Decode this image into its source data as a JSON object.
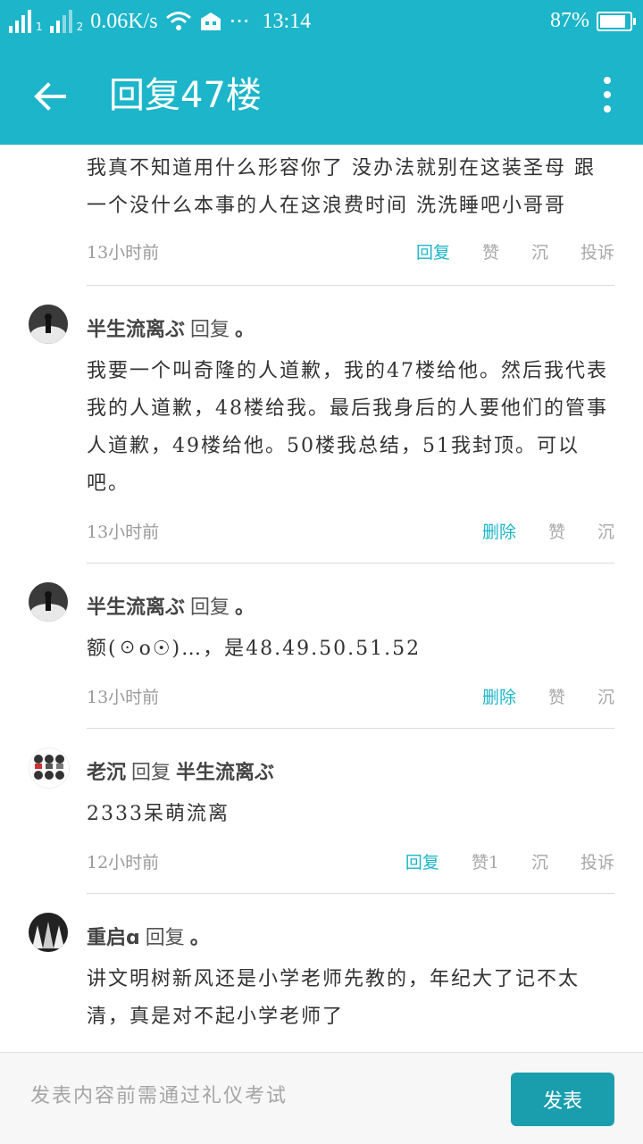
{
  "status_bar": {
    "network_speed": "0.06K/s",
    "dots": "···",
    "time": "13:14",
    "battery": "87%",
    "battery_level": 0.87,
    "sim1": "1",
    "sim2": "2"
  },
  "app_bar": {
    "title": "回复47楼"
  },
  "posts": [
    {
      "text": "我真不知道用什么形容你了 没办法就别在这装圣母 跟一个没什么本事的人在这浪费时间 洗洗睡吧小哥哥",
      "time": "13小时前",
      "actions": [
        "回复",
        "赞",
        "沉",
        "投诉"
      ]
    },
    {
      "author": "半生流离ぶ",
      "reply_word": "回复",
      "target": "。",
      "text": "我要一个叫奇隆的人道歉，我的47楼给他。然后我代表我的人道歉，48楼给我。最后我身后的人要他们的管事人道歉，49楼给他。50楼我总结，51我封顶。可以吧。",
      "time": "13小时前",
      "actions": [
        "删除",
        "赞",
        "沉"
      ]
    },
    {
      "author": "半生流离ぶ",
      "reply_word": "回复",
      "target": "。",
      "text": "额(☉o☉)…，是48.49.50.51.52",
      "time": "13小时前",
      "actions": [
        "删除",
        "赞",
        "沉"
      ]
    },
    {
      "author": "老沉",
      "reply_word": "回复",
      "target": "半生流离ぶ",
      "text": "2333呆萌流离",
      "time": "12小时前",
      "actions": [
        "回复",
        "赞1",
        "沉",
        "投诉"
      ]
    },
    {
      "author": "重启ɑ",
      "reply_word": "回复",
      "target": "。",
      "text": "讲文明树新风还是小学老师先教的，年纪大了记不太清，真是对不起小学老师了"
    }
  ],
  "bottom_bar": {
    "placeholder": "发表内容前需通过礼仪考试",
    "send_label": "发表"
  },
  "colors": {
    "primary": "#1cb5c9",
    "send_button": "#1a9eae",
    "muted": "#a8a8a8"
  }
}
